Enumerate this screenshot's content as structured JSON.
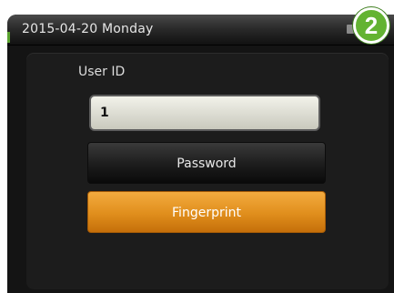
{
  "status_bar": {
    "date_label": "2015-04-20 Monday"
  },
  "login": {
    "user_id_label": "User ID",
    "user_id_value": "1",
    "password_button": "Password",
    "fingerprint_button": "Fingerprint"
  },
  "step_badge": {
    "number": "2"
  },
  "colors": {
    "accent_orange": "#e08e1c",
    "badge_green": "#63b332",
    "screen_background": "#141414"
  },
  "icons": {
    "status_indicator": "battery-icon"
  }
}
